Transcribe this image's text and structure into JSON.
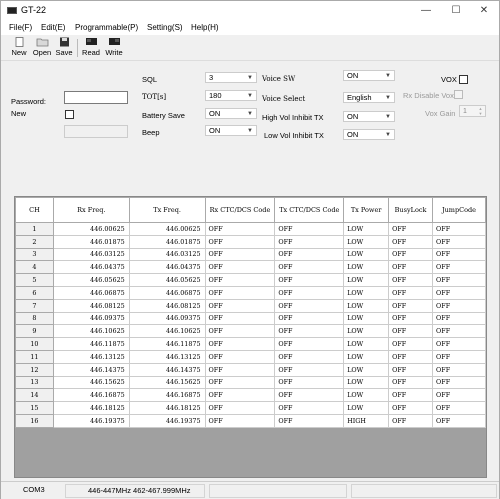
{
  "window": {
    "title": "GT-22",
    "minimize": "—",
    "maximize": "☐",
    "close": "✕"
  },
  "menu": [
    "File(F)",
    "Edit(E)",
    "Programmable(P)",
    "Setting(S)",
    "Help(H)"
  ],
  "toolbar": {
    "new": "New",
    "open": "Open",
    "save": "Save",
    "read": "Read",
    "write": "Write"
  },
  "password": {
    "label": "Password:",
    "value": "",
    "new_label": "New"
  },
  "settings": {
    "sql": {
      "label": "SQL",
      "value": "3"
    },
    "tot": {
      "label": "TOT[s]",
      "value": "180"
    },
    "battery_save": {
      "label": "Battery Save",
      "value": "ON"
    },
    "beep": {
      "label": "Beep",
      "value": "ON"
    },
    "voice_sw": {
      "label": "Voice SW",
      "value": "ON"
    },
    "voice_select": {
      "label": "Voice Select",
      "value": "English"
    },
    "high_vol": {
      "label": "High Vol Inhibit TX",
      "value": "ON"
    },
    "low_vol": {
      "label": "Low Vol Inhibit TX",
      "value": "ON"
    },
    "vox": {
      "label": "VOX"
    },
    "rx_disable_vox": {
      "label": "Rx Disable Vox"
    },
    "vox_gain": {
      "label": "Vox Gain",
      "value": "1"
    }
  },
  "grid": {
    "headers": [
      "CH",
      "Rx Freq.",
      "Tx Freq.",
      "Rx CTC/DCS Code",
      "Tx CTC/DCS Code",
      "Tx Power",
      "BusyLock",
      "JumpCode"
    ],
    "rows": [
      [
        "1",
        "446.00625",
        "446.00625",
        "OFF",
        "OFF",
        "LOW",
        "OFF",
        "OFF"
      ],
      [
        "2",
        "446.01875",
        "446.01875",
        "OFF",
        "OFF",
        "LOW",
        "OFF",
        "OFF"
      ],
      [
        "3",
        "446.03125",
        "446.03125",
        "OFF",
        "OFF",
        "LOW",
        "OFF",
        "OFF"
      ],
      [
        "4",
        "446.04375",
        "446.04375",
        "OFF",
        "OFF",
        "LOW",
        "OFF",
        "OFF"
      ],
      [
        "5",
        "446.05625",
        "446.05625",
        "OFF",
        "OFF",
        "LOW",
        "OFF",
        "OFF"
      ],
      [
        "6",
        "446.06875",
        "446.06875",
        "OFF",
        "OFF",
        "LOW",
        "OFF",
        "OFF"
      ],
      [
        "7",
        "446.08125",
        "446.08125",
        "OFF",
        "OFF",
        "LOW",
        "OFF",
        "OFF"
      ],
      [
        "8",
        "446.09375",
        "446.09375",
        "OFF",
        "OFF",
        "LOW",
        "OFF",
        "OFF"
      ],
      [
        "9",
        "446.10625",
        "446.10625",
        "OFF",
        "OFF",
        "LOW",
        "OFF",
        "OFF"
      ],
      [
        "10",
        "446.11875",
        "446.11875",
        "OFF",
        "OFF",
        "LOW",
        "OFF",
        "OFF"
      ],
      [
        "11",
        "446.13125",
        "446.13125",
        "OFF",
        "OFF",
        "LOW",
        "OFF",
        "OFF"
      ],
      [
        "12",
        "446.14375",
        "446.14375",
        "OFF",
        "OFF",
        "LOW",
        "OFF",
        "OFF"
      ],
      [
        "13",
        "446.15625",
        "446.15625",
        "OFF",
        "OFF",
        "LOW",
        "OFF",
        "OFF"
      ],
      [
        "14",
        "446.16875",
        "446.16875",
        "OFF",
        "OFF",
        "LOW",
        "OFF",
        "OFF"
      ],
      [
        "15",
        "446.18125",
        "446.18125",
        "OFF",
        "OFF",
        "LOW",
        "OFF",
        "OFF"
      ],
      [
        "16",
        "446.19375",
        "446.19375",
        "OFF",
        "OFF",
        "HIGH",
        "OFF",
        "OFF"
      ]
    ]
  },
  "status": {
    "port": "COM3",
    "bands": "446-447MHz 462-467.999MHz"
  }
}
